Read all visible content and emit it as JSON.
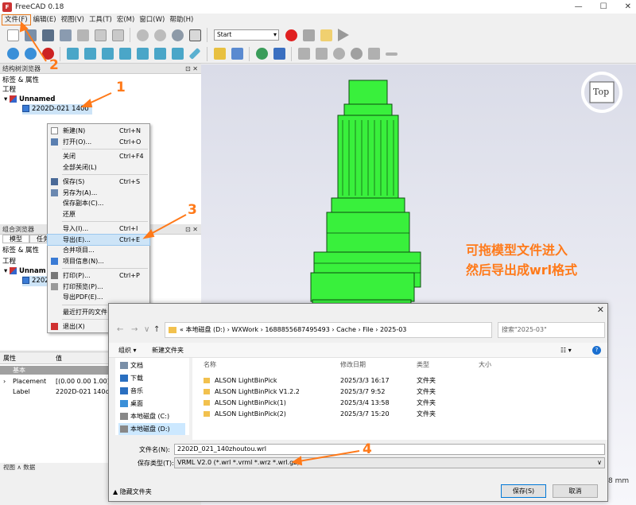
{
  "window": {
    "title": "FreeCAD 0.18",
    "min": "—",
    "max": "☐",
    "close": "✕"
  },
  "menubar": [
    "文件(F)",
    "编辑(E)",
    "视图(V)",
    "工具(T)",
    "宏(M)",
    "窗口(W)",
    "帮助(H)"
  ],
  "toolbar": {
    "macro_combo": "Start"
  },
  "tree_panel": {
    "title": "结构树浏览器",
    "header": "标签 & 属性",
    "section": "工程",
    "doc": "Unnamed",
    "item": "2202D-021 140o"
  },
  "combo_panel": {
    "title": "组合浏览器",
    "tabs": [
      "模型",
      "任务"
    ],
    "header": "标签 & 属性",
    "section": "工程",
    "doc": "Unnam",
    "item": "2202"
  },
  "properties": {
    "col_prop": "属性",
    "col_val": "值",
    "group": "基本",
    "rows": [
      {
        "name": "Placement",
        "value": "[(0.00 0.00 1.00);"
      },
      {
        "name": "Label",
        "value": "2202D-021 140o"
      }
    ],
    "tabs": "视图 ∧ 数据"
  },
  "context_menu": [
    {
      "label": "新建(N)",
      "shortcut": "Ctrl+N",
      "icon": "new-file-icon"
    },
    {
      "label": "打开(O)...",
      "shortcut": "Ctrl+O",
      "icon": "open-folder-icon"
    },
    {
      "sep": true
    },
    {
      "label": "关闭",
      "shortcut": "Ctrl+F4"
    },
    {
      "label": "全部关闭(L)",
      "shortcut": ""
    },
    {
      "sep": true
    },
    {
      "label": "保存(S)",
      "shortcut": "Ctrl+S",
      "icon": "save-icon"
    },
    {
      "label": "另存为(A)...",
      "shortcut": "",
      "icon": "save-as-icon"
    },
    {
      "label": "保存副本(C)...",
      "shortcut": ""
    },
    {
      "label": "还原",
      "shortcut": ""
    },
    {
      "sep": true
    },
    {
      "label": "导入(I)...",
      "shortcut": "Ctrl+I"
    },
    {
      "label": "导出(E)...",
      "shortcut": "Ctrl+E",
      "highlight": true
    },
    {
      "label": "合并项目...",
      "shortcut": ""
    },
    {
      "label": "项目信息(N)...",
      "shortcut": "",
      "icon": "info-icon"
    },
    {
      "sep": true
    },
    {
      "label": "打印(P)...",
      "shortcut": "Ctrl+P",
      "icon": "print-icon"
    },
    {
      "label": "打印预览(P)...",
      "shortcut": "",
      "icon": "print-preview-icon"
    },
    {
      "label": "导出PDF(E)...",
      "shortcut": ""
    },
    {
      "sep": true
    },
    {
      "label": "最近打开的文件",
      "shortcut": "▸"
    },
    {
      "sep": true
    },
    {
      "label": "退出(X)",
      "shortcut": "Alt+F4",
      "icon": "exit-icon"
    }
  ],
  "view3d": {
    "navcube_face": "Top",
    "annotation_line1": "可拖模型文件进入",
    "annotation_line2": "然后导出成wrl格式",
    "edge_text": "8 mm"
  },
  "dialog": {
    "address": [
      "本地磁盘 (D:)",
      "WXWork",
      "1688855687495493",
      "Cache",
      "File",
      "2025-03"
    ],
    "address_prefix": "«",
    "search_placeholder": "搜索\"2025-03\"",
    "organize": "组织 ▾",
    "new_folder": "新建文件夹",
    "nav": [
      {
        "label": "文档",
        "icon": "documents-icon"
      },
      {
        "label": "下载",
        "icon": "download-icon"
      },
      {
        "label": "音乐",
        "icon": "music-icon"
      },
      {
        "label": "桌面",
        "icon": "desktop-icon"
      },
      {
        "label": "本地磁盘 (C:)",
        "icon": "drive-icon"
      },
      {
        "label": "本地磁盘 (D:)",
        "icon": "drive-icon",
        "selected": true
      }
    ],
    "columns": [
      "名称",
      "修改日期",
      "类型",
      "大小"
    ],
    "files": [
      {
        "name": "ALSON LightBinPick",
        "date": "2025/3/3 16:17",
        "type": "文件夹"
      },
      {
        "name": "ALSON LightBinPick V1.2.2",
        "date": "2025/3/7 9:52",
        "type": "文件夹"
      },
      {
        "name": "ALSON LightBinPick(1)",
        "date": "2025/3/4 13:58",
        "type": "文件夹"
      },
      {
        "name": "ALSON LightBinPick(2)",
        "date": "2025/3/7 15:20",
        "type": "文件夹"
      }
    ],
    "filename_label": "文件名(N):",
    "filename_value": "2202D_021_140zhoutou.wrl",
    "filetype_label": "保存类型(T):",
    "filetype_value": "VRML V2.0 (*.wrl *.vrml *.wrz *.wrl.gz)",
    "hide_folders": "隐藏文件夹",
    "save": "保存(S)",
    "cancel": "取消"
  },
  "callouts": [
    "1",
    "2",
    "3",
    "4"
  ],
  "colors": {
    "accent": "#ff7a1a",
    "model": "#39f03c",
    "highlight": "#cde4f7"
  }
}
